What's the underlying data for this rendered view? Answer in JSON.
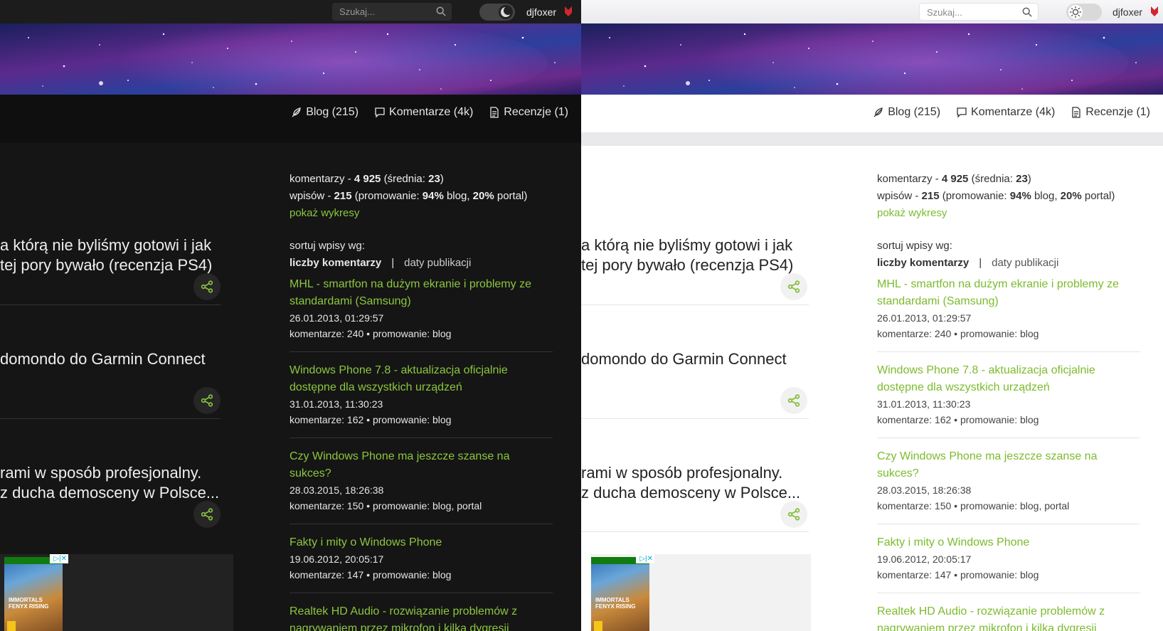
{
  "header": {
    "search_placeholder": "Szukaj...",
    "username": "djfoxer"
  },
  "nav": {
    "blog": "Blog (215)",
    "comments": "Komentarze (4k)",
    "reviews": "Recenzje (1)"
  },
  "left_posts": {
    "p1_line1": "a którą nie byliśmy gotowi i jak",
    "p1_line2": "tej pory bywało (recenzja PS4)",
    "p2_line1": "domondo do Garmin Connect",
    "p3_line1": "rami w sposób profesjonalny.",
    "p3_line2": "z ducha demosceny w Polsce..."
  },
  "stats": {
    "comments_prefix": "komentarzy - ",
    "comments_count": "4 925",
    "comments_avg_prefix": " (średnia: ",
    "comments_avg": "23",
    "comments_avg_suffix": ")",
    "posts_prefix": "wpisów - ",
    "posts_count": "215",
    "posts_promo_prefix": " (promowanie: ",
    "posts_promo_blog": "94%",
    "posts_promo_mid": " blog, ",
    "posts_promo_portal": "20%",
    "posts_promo_suffix": " portal)",
    "show_charts": "pokaż wykresy"
  },
  "sort": {
    "label": "sortuj wpisy wg:",
    "by_comments": "liczby komentarzy",
    "divider": "|",
    "by_date": "daty publikacji"
  },
  "entries": [
    {
      "title": "MHL - smartfon na dużym ekranie i problemy ze standardami (Samsung)",
      "date": "26.01.2013, 01:29:57",
      "meta": "komentarze: 240 • promowanie: blog"
    },
    {
      "title": "Windows Phone 7.8 - aktualizacja oficjalnie dostępne dla wszystkich urządzeń",
      "date": "31.01.2013, 11:30:23",
      "meta": "komentarze: 162 • promowanie: blog"
    },
    {
      "title": "Czy Windows Phone ma jeszcze szanse na sukces?",
      "date": "28.03.2015, 18:26:38",
      "meta": "komentarze: 150 • promowanie: blog, portal"
    },
    {
      "title": "Fakty i mity o Windows Phone",
      "date": "19.06.2012, 20:05:17",
      "meta": "komentarze: 147 • promowanie: blog"
    },
    {
      "title": "Realtek HD Audio - rozwiązanie problemów z nagrywaniem przez mikrofon i kilka dygresji",
      "date": "",
      "meta": ""
    }
  ],
  "ad": {
    "game_title": "IMMORTALS FENYX RISING",
    "close_label": "▷|✕"
  },
  "colors": {
    "accent_green": "#8cc63f",
    "dark_bg": "#151515",
    "light_bg": "#ffffff"
  }
}
